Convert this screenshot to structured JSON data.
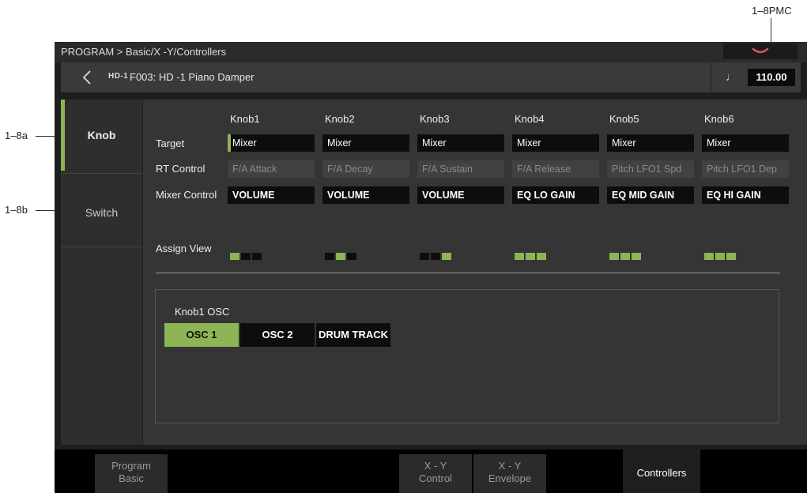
{
  "callouts": {
    "top_right": "1–8PMC",
    "left_a": "1–8a",
    "left_b": "1–8b"
  },
  "topbar": {
    "breadcrumb": "PROGRAM > Basic/X -Y/Controllers",
    "menu_button_icon": "chevron-down-icon"
  },
  "header": {
    "back_icon": "back-arrow-icon",
    "logo": "HD-1",
    "program_name": "F003: HD -1 Piano Damper",
    "tempo_icon": "quarter-note-icon",
    "tempo_symbol": "♩",
    "tempo": "110.00"
  },
  "sidebar": {
    "tabs": [
      {
        "label": "Knob",
        "selected": true
      },
      {
        "label": "Switch",
        "selected": false
      }
    ]
  },
  "knob_page": {
    "row_labels": {
      "target": "Target",
      "rt_control": "RT Control",
      "mixer_control": "Mixer Control",
      "assign_view": "Assign View"
    },
    "knobs": [
      {
        "name": "Knob1",
        "target": "Mixer",
        "rt_control": "F/A Attack",
        "mixer_control": "VOLUME",
        "assign_view": [
          true,
          false,
          false
        ]
      },
      {
        "name": "Knob2",
        "target": "Mixer",
        "rt_control": "F/A Decay",
        "mixer_control": "VOLUME",
        "assign_view": [
          false,
          true,
          false
        ]
      },
      {
        "name": "Knob3",
        "target": "Mixer",
        "rt_control": "F/A Sustain",
        "mixer_control": "VOLUME",
        "assign_view": [
          false,
          false,
          true
        ]
      },
      {
        "name": "Knob4",
        "target": "Mixer",
        "rt_control": "F/A Release",
        "mixer_control": "EQ LO GAIN",
        "assign_view": [
          true,
          true,
          true
        ]
      },
      {
        "name": "Knob5",
        "target": "Mixer",
        "rt_control": "Pitch LFO1 Spd",
        "mixer_control": "EQ MID GAIN",
        "assign_view": [
          true,
          true,
          true
        ]
      },
      {
        "name": "Knob6",
        "target": "Mixer",
        "rt_control": "Pitch LFO1 Dep",
        "mixer_control": "EQ HI GAIN",
        "assign_view": [
          true,
          true,
          true
        ]
      }
    ],
    "osc_panel": {
      "title": "Knob1 OSC",
      "buttons": [
        {
          "label": "OSC 1",
          "selected": true
        },
        {
          "label": "OSC 2",
          "selected": false
        },
        {
          "label": "DRUM TRACK",
          "selected": false
        }
      ]
    }
  },
  "bottom_tabs": [
    {
      "line1": "Program",
      "line2": "Basic",
      "selected": false
    },
    {
      "line1": "X - Y",
      "line2": "Control",
      "selected": false
    },
    {
      "line1": "X - Y",
      "line2": "Envelope",
      "selected": false
    },
    {
      "label": "Controllers",
      "selected": true
    }
  ],
  "colors": {
    "accent": "#8db556",
    "background": "#1e1e1e",
    "field": "#0d0d0d"
  }
}
